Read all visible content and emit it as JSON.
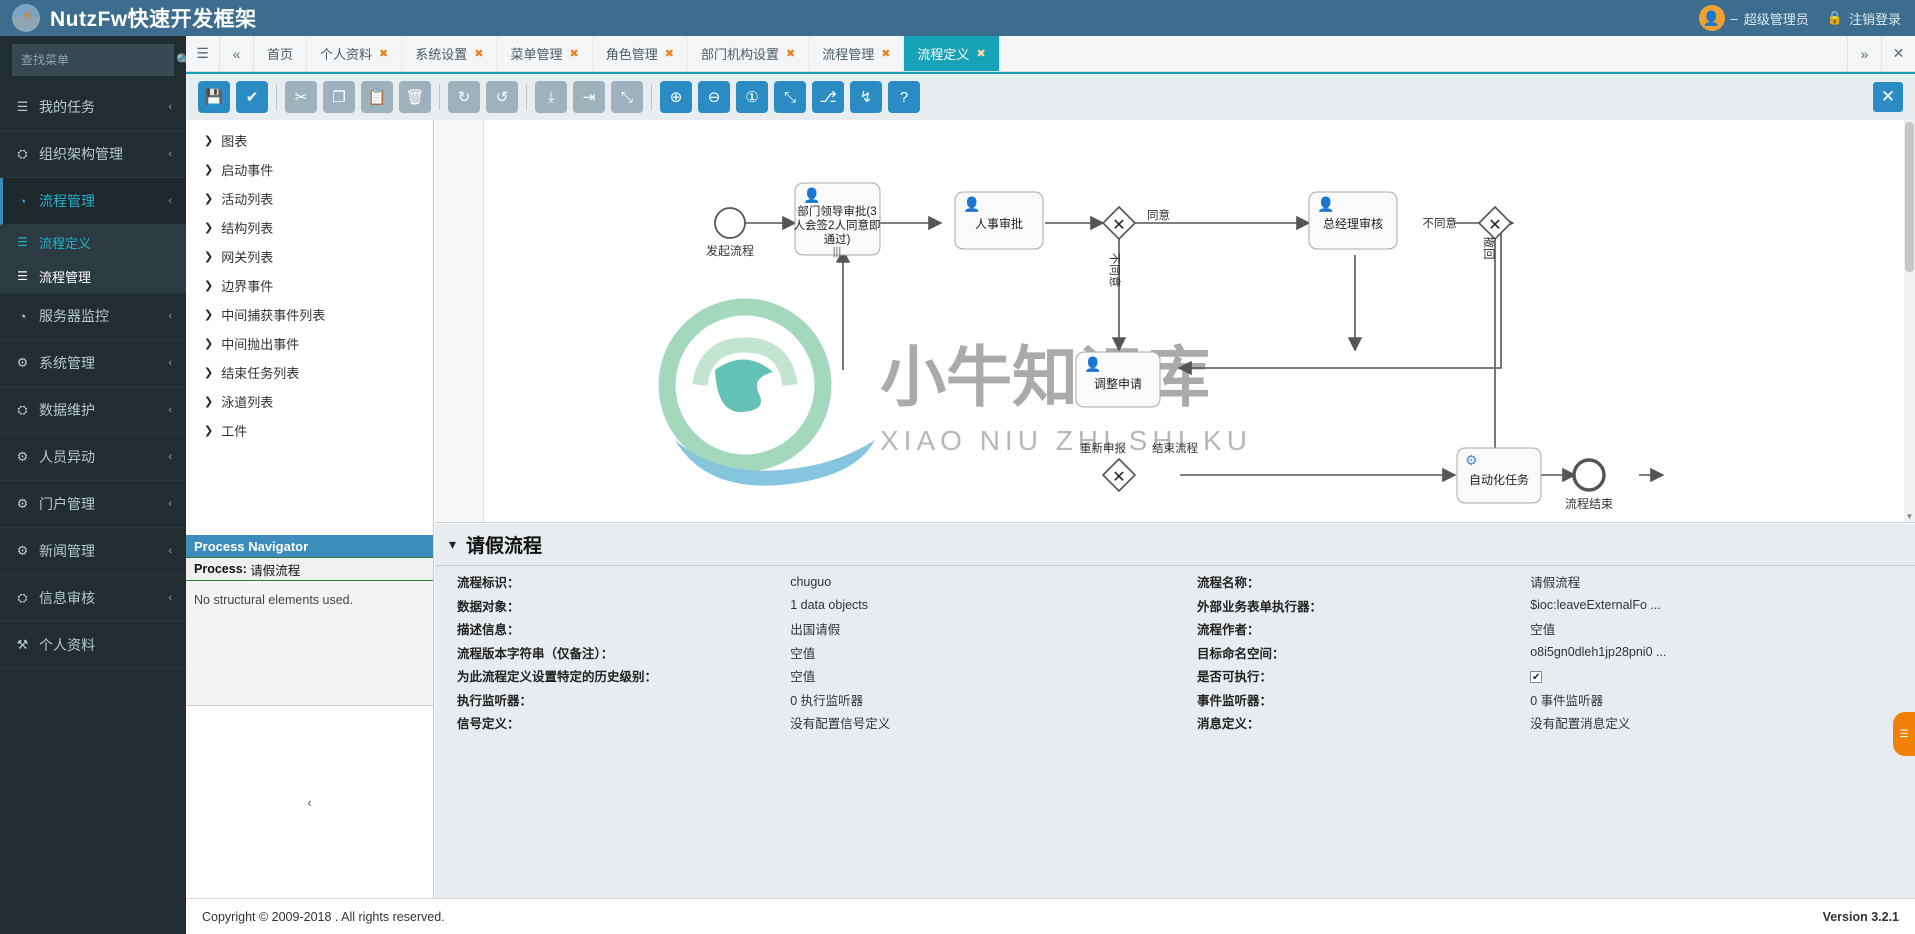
{
  "topbar": {
    "brand": "NutzFw快速开发框架",
    "logo_icon": "lightning-bolt-icon",
    "user": "超级管理员",
    "user_prefix": "–",
    "logout": "注销登录",
    "logout_icon": "lock-icon",
    "avatar_icon": "avatar-icon"
  },
  "sidebar": {
    "search_placeholder": "查找菜单",
    "search_icon": "search-icon",
    "items": [
      {
        "label": "我的任务",
        "icon": "list-icon",
        "arrow": "‹",
        "state": "normal"
      },
      {
        "label": "组织架构管理",
        "icon": "sitemap-icon",
        "arrow": "‹",
        "state": "normal"
      },
      {
        "label": "流程管理",
        "icon": "dashboard-icon",
        "arrow": "‹",
        "state": "open"
      },
      {
        "label": "服务器监控",
        "icon": "dashboard-icon",
        "arrow": "‹",
        "state": "normal"
      },
      {
        "label": "系统管理",
        "icon": "gears-icon",
        "arrow": "‹",
        "state": "normal"
      },
      {
        "label": "数据维护",
        "icon": "sitemap-icon",
        "arrow": "‹",
        "state": "normal"
      },
      {
        "label": "人员异动",
        "icon": "gears-icon",
        "arrow": "‹",
        "state": "normal"
      },
      {
        "label": "门户管理",
        "icon": "gears-icon",
        "arrow": "‹",
        "state": "normal"
      },
      {
        "label": "新闻管理",
        "icon": "gears-icon",
        "arrow": "‹",
        "state": "normal"
      },
      {
        "label": "信息审核",
        "icon": "sitemap-icon",
        "arrow": "‹",
        "state": "normal"
      },
      {
        "label": "个人资料",
        "icon": "wrench-icon",
        "arrow": "",
        "state": "normal"
      }
    ],
    "submenu": [
      {
        "label": "流程定义",
        "icon": "list-icon",
        "active": true
      },
      {
        "label": "流程管理",
        "icon": "list-icon",
        "active": false
      }
    ]
  },
  "tabbar": {
    "menu_icon": "hamburger-icon",
    "prev_icon": "double-chevron-left-icon",
    "next_icon": "double-chevron-right-icon",
    "close_icon": "close-icon",
    "tabs": [
      {
        "label": "首页",
        "closable": false,
        "active": false
      },
      {
        "label": "个人资料",
        "closable": true,
        "active": false
      },
      {
        "label": "系统设置",
        "closable": true,
        "active": false
      },
      {
        "label": "菜单管理",
        "closable": true,
        "active": false
      },
      {
        "label": "角色管理",
        "closable": true,
        "active": false
      },
      {
        "label": "部门机构设置",
        "closable": true,
        "active": false
      },
      {
        "label": "流程管理",
        "closable": true,
        "active": false
      },
      {
        "label": "流程定义",
        "closable": true,
        "active": true
      }
    ]
  },
  "toolbar": {
    "buttons": [
      {
        "name": "save-button",
        "icon": "floppy-disk-icon",
        "style": "blue"
      },
      {
        "name": "validate-button",
        "icon": "check-icon",
        "style": "blue"
      },
      {
        "name": "cut-button",
        "icon": "scissors-icon",
        "style": "grey"
      },
      {
        "name": "copy-button",
        "icon": "copy-icon",
        "style": "grey"
      },
      {
        "name": "paste-button",
        "icon": "paste-icon",
        "style": "grey"
      },
      {
        "name": "delete-button",
        "icon": "trash-icon",
        "style": "grey"
      },
      {
        "name": "redo-button",
        "icon": "redo-icon",
        "style": "grey"
      },
      {
        "name": "undo-button",
        "icon": "undo-icon",
        "style": "grey"
      },
      {
        "name": "align-vertical-button",
        "icon": "align-vertical-icon",
        "style": "grey"
      },
      {
        "name": "align-horizontal-button",
        "icon": "align-horizontal-icon",
        "style": "grey"
      },
      {
        "name": "resize-button",
        "icon": "resize-icon",
        "style": "grey"
      },
      {
        "name": "zoom-in-button",
        "icon": "zoom-in-icon",
        "style": "blue"
      },
      {
        "name": "zoom-out-button",
        "icon": "zoom-out-icon",
        "style": "blue"
      },
      {
        "name": "zoom-actual-button",
        "icon": "zoom-actual-icon",
        "style": "blue"
      },
      {
        "name": "zoom-fit-button",
        "icon": "zoom-fit-icon",
        "style": "blue"
      },
      {
        "name": "morph-button",
        "icon": "morph-icon",
        "style": "blue"
      },
      {
        "name": "flow-button",
        "icon": "flow-icon",
        "style": "blue"
      },
      {
        "name": "help-button",
        "icon": "question-icon",
        "style": "blue"
      }
    ],
    "close_label": "✕"
  },
  "left_panel": {
    "tree": [
      "图表",
      "启动事件",
      "活动列表",
      "结构列表",
      "网关列表",
      "边界事件",
      "中间捕获事件列表",
      "中间抛出事件",
      "结束任务列表",
      "泳道列表",
      "工件"
    ],
    "navigator_title": "Process Navigator",
    "navigator_process_label": "Process:",
    "navigator_process_value": "请假流程",
    "navigator_body": "No structural elements used.",
    "collapse_icon": "chevron-left-icon"
  },
  "diagram": {
    "watermark_main": "小牛知识库",
    "watermark_sub": "XIAO NIU ZHI SHI KU",
    "nodes": [
      {
        "id": "start",
        "type": "start-event",
        "label": "发起流程"
      },
      {
        "id": "dept",
        "type": "user-task",
        "label": "部门领导审批(3人会签2人同意即通过)"
      },
      {
        "id": "hr",
        "type": "user-task",
        "label": "人事审批"
      },
      {
        "id": "gw1",
        "type": "exclusive-gateway",
        "label": ""
      },
      {
        "id": "gm",
        "type": "user-task",
        "label": "总经理审核"
      },
      {
        "id": "gw2",
        "type": "exclusive-gateway",
        "label": ""
      },
      {
        "id": "adjust",
        "type": "user-task",
        "label": "调整申请"
      },
      {
        "id": "gw3",
        "type": "exclusive-gateway",
        "label": ""
      },
      {
        "id": "auto",
        "type": "service-task",
        "label": "自动化任务"
      },
      {
        "id": "end",
        "type": "end-event",
        "label": "流程结束"
      }
    ],
    "edge_labels": [
      "同意",
      "不同意",
      "不同意",
      "撤回",
      "重新申报",
      "结束流程"
    ]
  },
  "properties": {
    "collapse_icon": "chevron-down-icon",
    "title": "请假流程",
    "left_rows": [
      {
        "label": "流程标识：",
        "value": "chuguo"
      },
      {
        "label": "数据对象：",
        "value": "1 data objects"
      },
      {
        "label": "描述信息：",
        "value": "出国请假"
      },
      {
        "label": "流程版本字符串（仅备注）：",
        "value": "空值"
      },
      {
        "label": "为此流程定义设置特定的历史级别：",
        "value": "空值"
      },
      {
        "label": "执行监听器：",
        "value": "0 执行监听器"
      },
      {
        "label": "信号定义：",
        "value": "没有配置信号定义"
      }
    ],
    "right_rows": [
      {
        "label": "流程名称：",
        "value": "请假流程"
      },
      {
        "label": "外部业务表单执行器：",
        "value": "$ioc:leaveExternalFo ..."
      },
      {
        "label": "流程作者：",
        "value": "空值"
      },
      {
        "label": "目标命名空间：",
        "value": "o8i5gn0dleh1jp28pni0 ..."
      },
      {
        "label": "是否可执行：",
        "value": "",
        "checkbox": true
      },
      {
        "label": "事件监听器：",
        "value": "0 事件监听器"
      },
      {
        "label": "消息定义：",
        "value": "没有配置消息定义"
      }
    ]
  },
  "footer": {
    "copyright": "Copyright © 2009-2018 . All rights reserved.",
    "version": "Version 3.2.1"
  },
  "colors": {
    "brand_bg": "#3d6d8e",
    "sidebar_bg": "#222d32",
    "accent": "#17a2b8",
    "tool_blue": "#2b8cc4",
    "tab_close": "#e8821a"
  }
}
